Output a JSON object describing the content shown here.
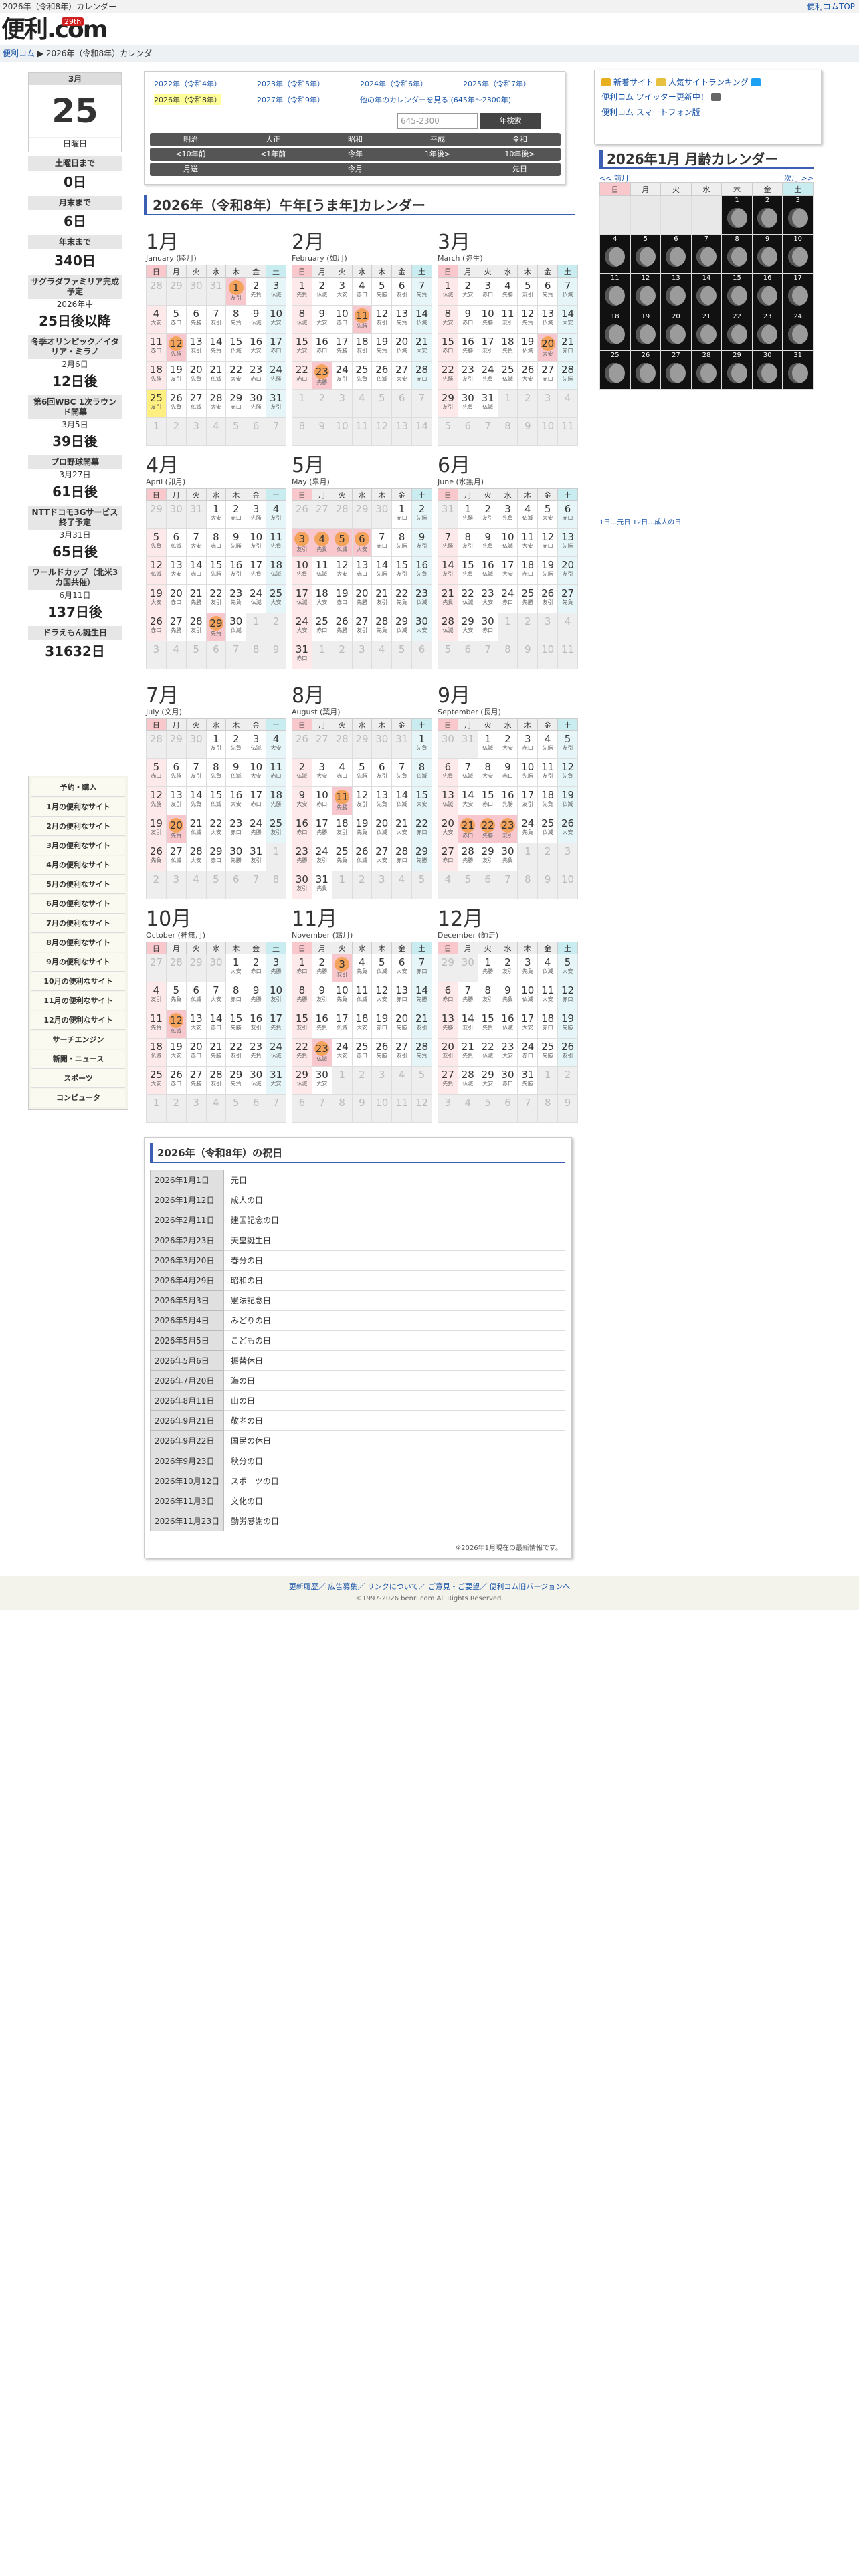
{
  "topbar": {
    "title": "2026年（令和8年）カレンダー",
    "top_link": "便利コムTOP"
  },
  "logo": {
    "text": "便利.com",
    "badge": "29th"
  },
  "breadcrumb": {
    "home": "便利コム",
    "sep": "▶",
    "current": "2026年（令和8年）カレンダー"
  },
  "today": {
    "month": "3月",
    "day": "25",
    "weekday": "日曜日"
  },
  "countdowns": [
    {
      "h": "土曜日まで",
      "s": "",
      "v": "0日"
    },
    {
      "h": "月末まで",
      "s": "",
      "v": "6日"
    },
    {
      "h": "年末まで",
      "s": "",
      "v": "340日"
    },
    {
      "h": "サグラダファミリア完成予定",
      "s": "2026年中",
      "v": "25日後以降"
    },
    {
      "h": "冬季オリンピック／イタリア・ミラノ",
      "s": "2月6日",
      "v": "12日後"
    },
    {
      "h": "第6回WBC 1次ラウンド開幕",
      "s": "3月5日",
      "v": "39日後"
    },
    {
      "h": "プロ野球開幕",
      "s": "3月27日",
      "v": "61日後"
    },
    {
      "h": "NTTドコモ3Gサービス終了予定",
      "s": "3月31日",
      "v": "65日後"
    },
    {
      "h": "ワールドカップ（北米3カ国共催）",
      "s": "6月11日",
      "v": "137日後"
    },
    {
      "h": "ドラえもん誕生日",
      "s": "",
      "v": "31632日"
    }
  ],
  "menu": [
    "予約・購入",
    "1月の便利なサイト",
    "2月の便利なサイト",
    "3月の便利なサイト",
    "4月の便利なサイト",
    "5月の便利なサイト",
    "6月の便利なサイト",
    "7月の便利なサイト",
    "8月の便利なサイト",
    "9月の便利なサイト",
    "10月の便利なサイト",
    "11月の便利なサイト",
    "12月の便利なサイト",
    "サーチエンジン",
    "新聞・ニュース",
    "スポーツ",
    "コンピュータ"
  ],
  "nav": {
    "years": [
      "2022年（令和4年）",
      "2023年（令和5年）",
      "2024年（令和6年）",
      "2025年（令和7年）",
      "2026年（令和8年）",
      "2027年（令和9年）",
      "他の年のカレンダーを見る (645年〜2300年)"
    ],
    "search_placeholder": "645-2300",
    "search_button": "年検索",
    "eras": [
      "明治",
      "大正",
      "昭和",
      "平成",
      "令和"
    ],
    "jumps": [
      "<10年前",
      "<1年前",
      "今年",
      "1年後>",
      "10年後>"
    ],
    "months_row": [
      "月送",
      "",
      "今月",
      "",
      "先日"
    ]
  },
  "page_title": "2026年（令和8年）午年[うま年]カレンダー",
  "weekdays": [
    "日",
    "月",
    "火",
    "水",
    "木",
    "金",
    "土"
  ],
  "months": [
    {
      "t": "1月",
      "s": "January (睦月)"
    },
    {
      "t": "2月",
      "s": "February (如月)"
    },
    {
      "t": "3月",
      "s": "March (弥生)"
    },
    {
      "t": "4月",
      "s": "April (卯月)"
    },
    {
      "t": "5月",
      "s": "May (皐月)"
    },
    {
      "t": "6月",
      "s": "June (水無月)"
    },
    {
      "t": "7月",
      "s": "July (文月)"
    },
    {
      "t": "8月",
      "s": "August (葉月)"
    },
    {
      "t": "9月",
      "s": "September (長月)"
    },
    {
      "t": "10月",
      "s": "October (神無月)"
    },
    {
      "t": "11月",
      "s": "November (霜月)"
    },
    {
      "t": "12月",
      "s": "December (師走)"
    }
  ],
  "holidays_title": "2026年（令和8年）の祝日",
  "holidays": [
    [
      "2026年1月1日",
      "元日"
    ],
    [
      "2026年1月12日",
      "成人の日"
    ],
    [
      "2026年2月11日",
      "建国記念の日"
    ],
    [
      "2026年2月23日",
      "天皇誕生日"
    ],
    [
      "2026年3月20日",
      "春分の日"
    ],
    [
      "2026年4月29日",
      "昭和の日"
    ],
    [
      "2026年5月3日",
      "憲法記念日"
    ],
    [
      "2026年5月4日",
      "みどりの日"
    ],
    [
      "2026年5月5日",
      "こどもの日"
    ],
    [
      "2026年5月6日",
      "振替休日"
    ],
    [
      "2026年7月20日",
      "海の日"
    ],
    [
      "2026年8月11日",
      "山の日"
    ],
    [
      "2026年9月21日",
      "敬老の日"
    ],
    [
      "2026年9月22日",
      "国民の休日"
    ],
    [
      "2026年9月23日",
      "秋分の日"
    ],
    [
      "2026年10月12日",
      "スポーツの日"
    ],
    [
      "2026年11月3日",
      "文化の日"
    ],
    [
      "2026年11月23日",
      "勤労感謝の日"
    ]
  ],
  "holidays_note": "※2026年1月現在の最新情報です。",
  "right": {
    "links": [
      "新着サイト",
      "人気サイトランキング",
      "便利コム ツイッター更新中！",
      "便利コム スマートフォン版"
    ],
    "link_colors": [
      "#e8b020",
      "#e8c040",
      "#1da1f2",
      "#666666"
    ]
  },
  "moon": {
    "title": "2026年1月 月齢カレンダー",
    "prev": "<< 前月",
    "next": "次月 >>",
    "foot": "1日…元日  12日…成人の日"
  },
  "footer": {
    "links": "更新履歴／ 広告募集／ リンクについて／ ご意見・ご要望／ 便利コム旧バージョンへ",
    "copy": "©1997-2026 benri.com All Rights Reserved."
  }
}
